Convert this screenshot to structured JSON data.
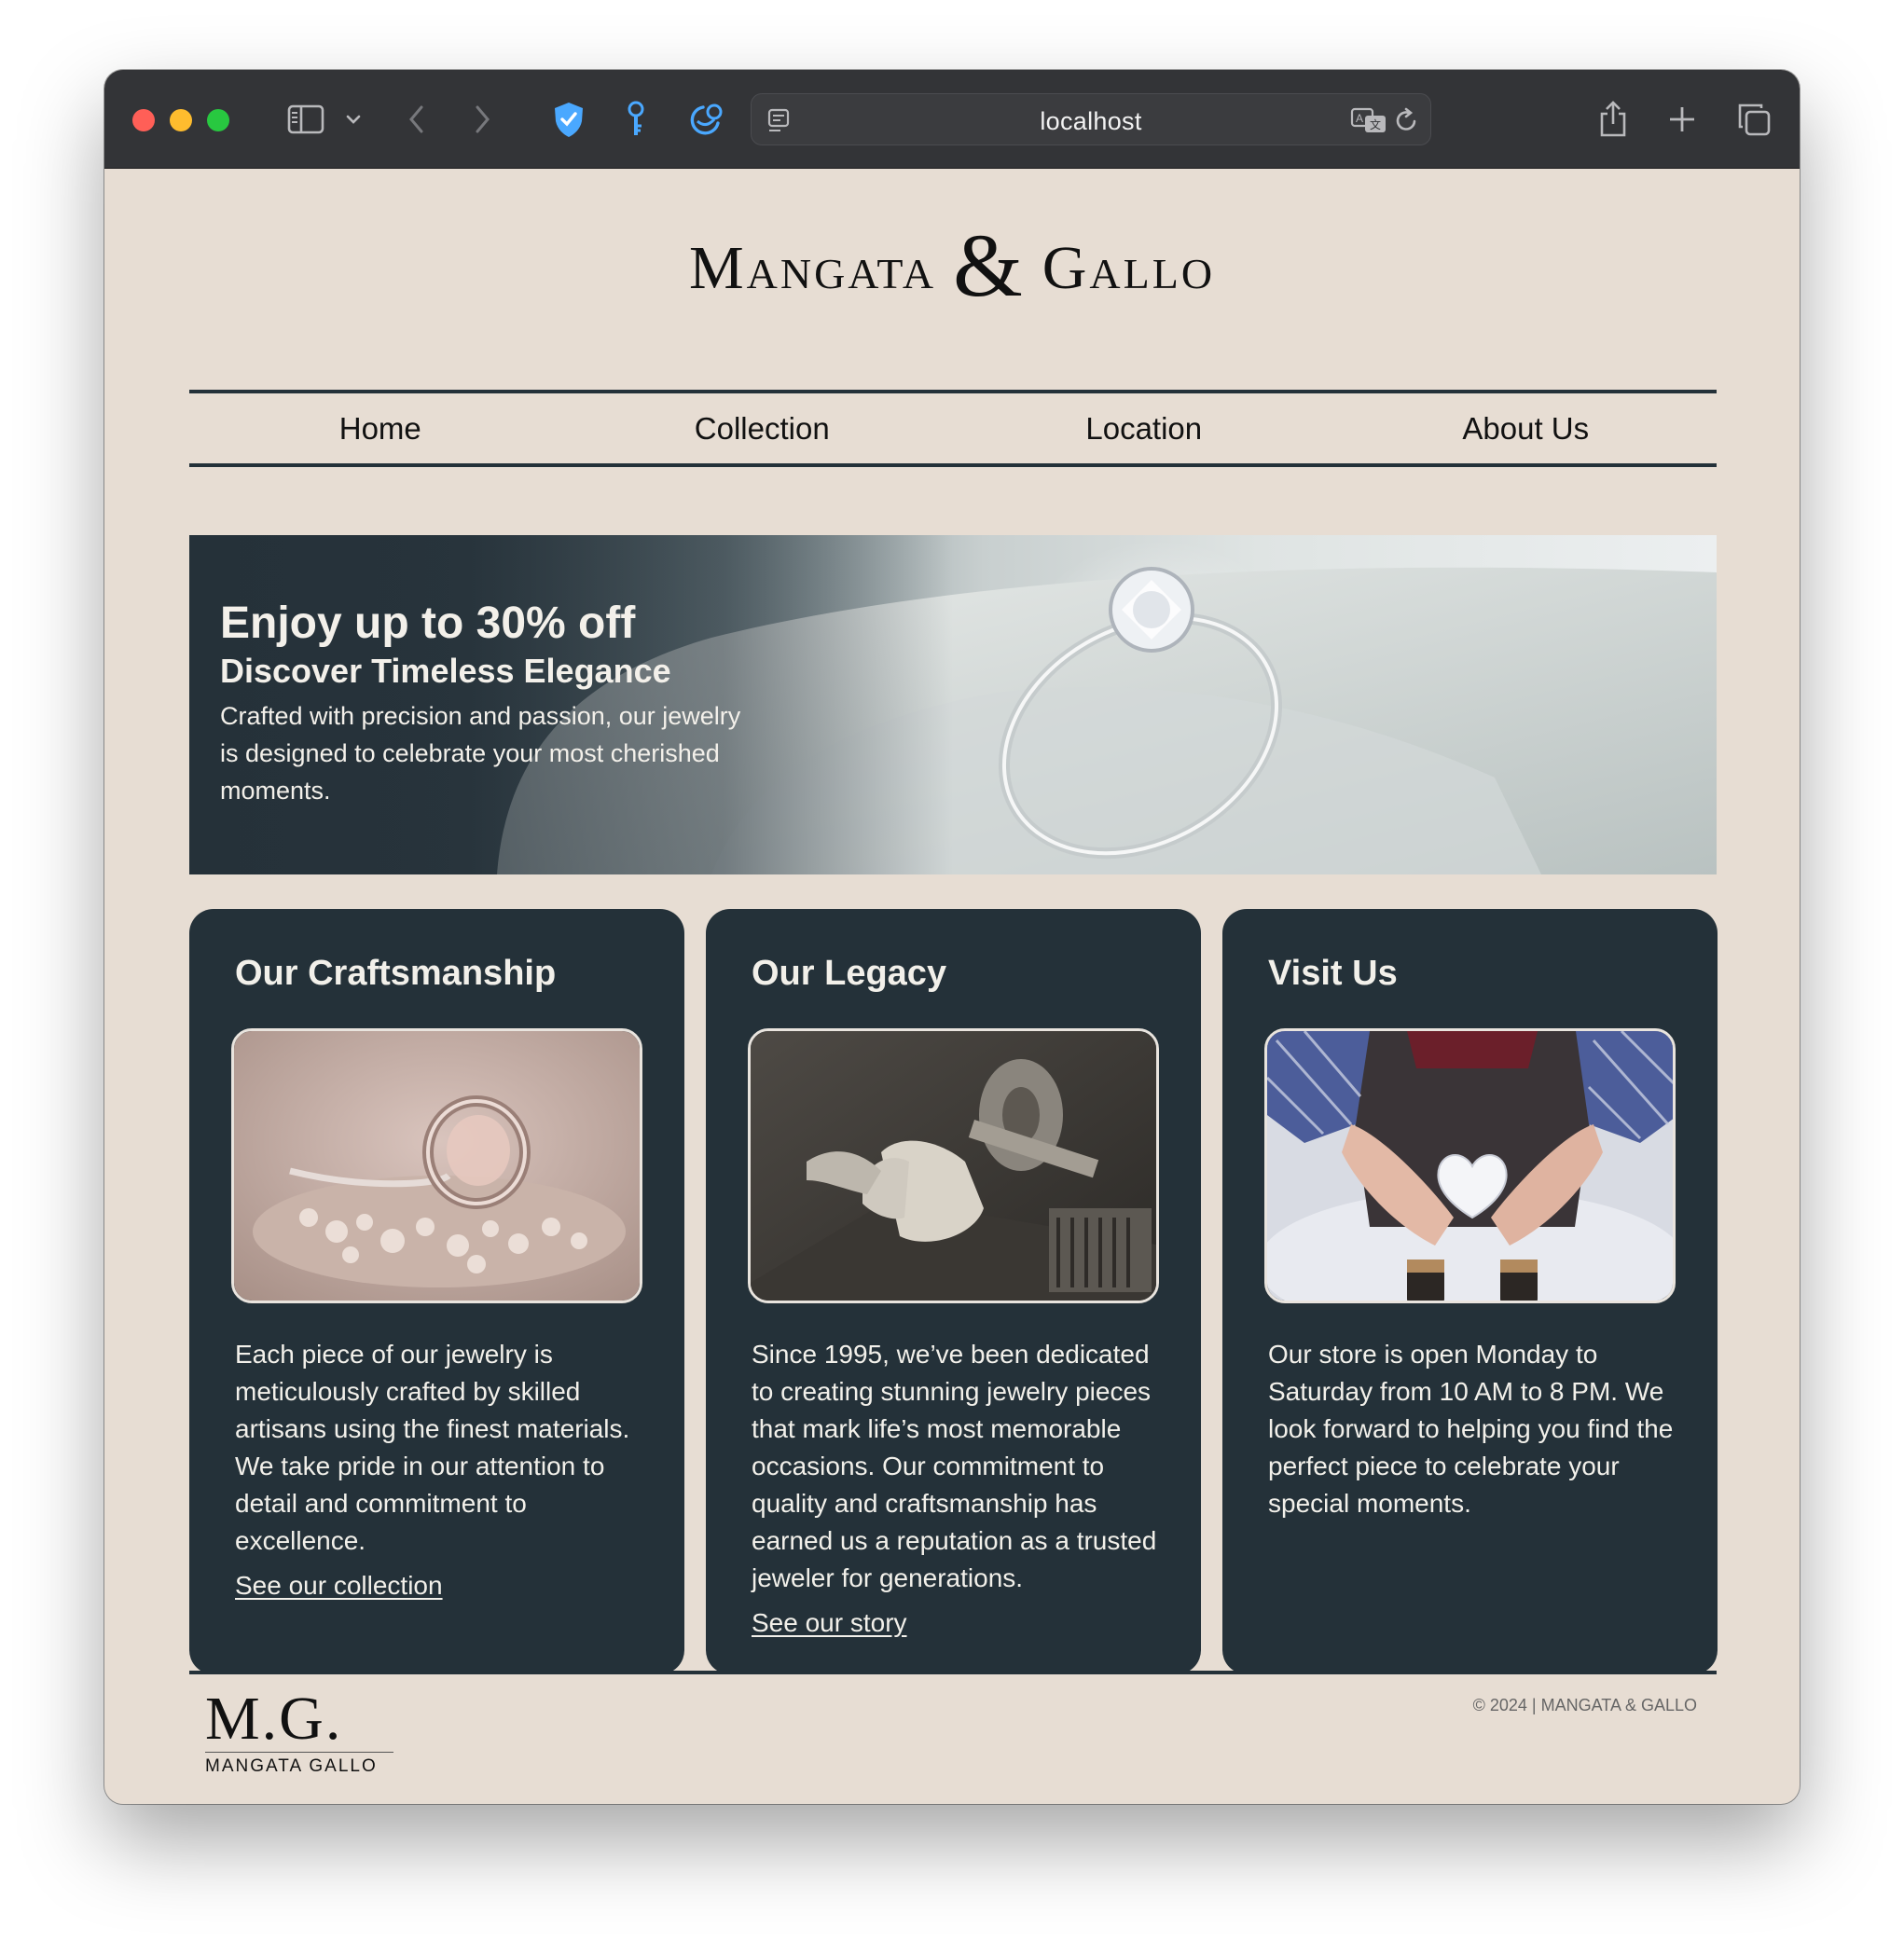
{
  "browser": {
    "url": "localhost",
    "colors": {
      "close": "#ff5f57",
      "minimize": "#febc2e",
      "zoom": "#28c840",
      "accent": "#4aa8ff"
    },
    "icons": [
      "sidebar-icon",
      "chevron-down-icon",
      "back-icon",
      "forward-icon",
      "shield-icon",
      "key-icon",
      "extension-icon",
      "reader-icon",
      "translate-icon",
      "reload-icon",
      "share-icon",
      "new-tab-icon",
      "tabs-overview-icon"
    ]
  },
  "site": {
    "logo_left": "Mangata",
    "logo_amp": "&",
    "logo_right": "Gallo",
    "nav": [
      {
        "label": "Home"
      },
      {
        "label": "Collection"
      },
      {
        "label": "Location"
      },
      {
        "label": "About Us"
      }
    ]
  },
  "hero": {
    "headline": "Enjoy up to 30% off",
    "subheadline": "Discover Timeless Elegance",
    "body": "Crafted with precision and passion, our jewelry is designed to celebrate your most cherished moments."
  },
  "cards": [
    {
      "title": "Our Craftsmanship",
      "body": "Each piece of our jewelry is meticulously crafted by skilled artisans using the finest materials. We take pride in our attention to detail and commitment to excellence.",
      "link": "See our collection"
    },
    {
      "title": "Our Legacy",
      "body": "Since 1995, we’ve been dedicated to creating stunning jewelry pieces that mark life’s most memorable occasions. Our commitment to quality and craftsmanship has earned us a reputation as a trusted jeweler for generations.",
      "link": "See our story"
    },
    {
      "title": "Visit Us",
      "body": "Our store is open Monday to Saturday from 10 AM to 8 PM. We look forward to helping you find the perfect piece to celebrate your special moments."
    }
  ],
  "footer": {
    "logo_mark": "M.G.",
    "logo_text": "MANGATA GALLO",
    "copyright": "© 2024 | MANGATA & GALLO"
  },
  "theme": {
    "background": "#e7ddd3",
    "dark": "#243139",
    "text_light": "#f2f0ea"
  }
}
